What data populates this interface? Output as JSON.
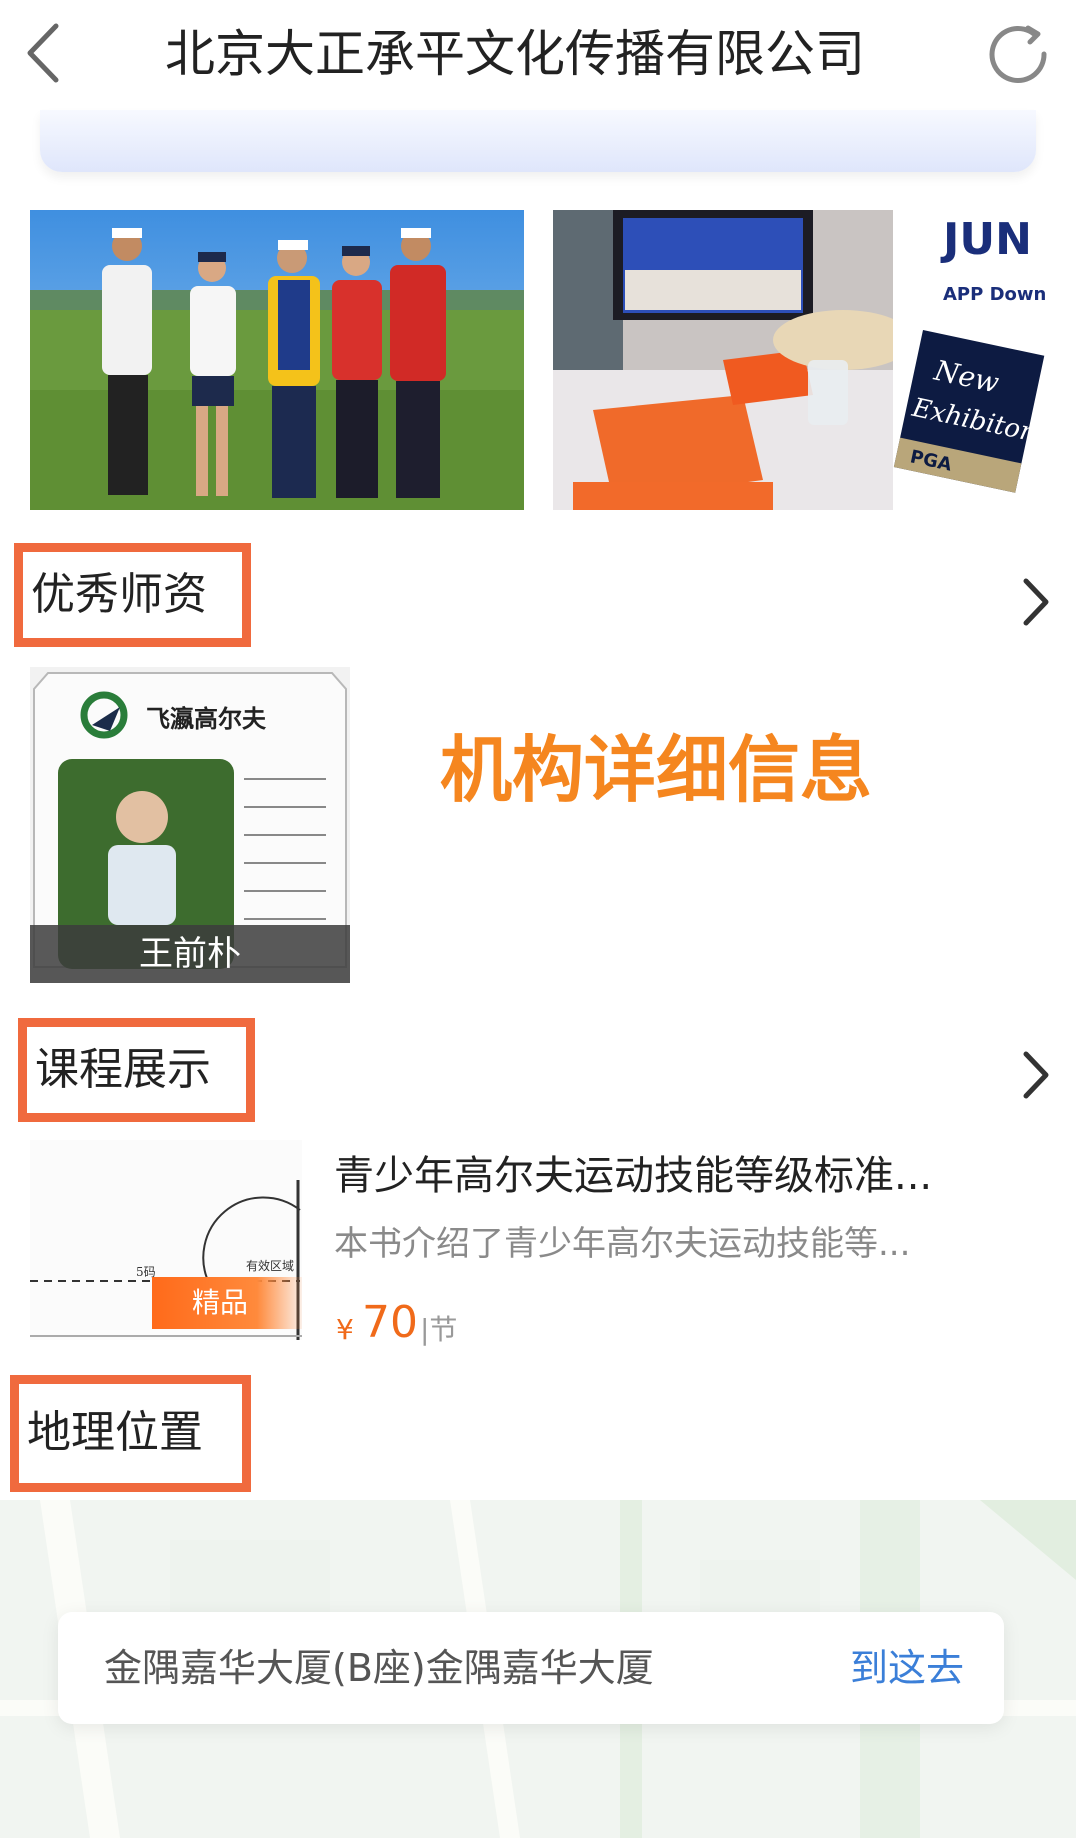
{
  "header": {
    "title": "北京大正承平文化传播有限公司",
    "back_icon": "chevron-left-icon",
    "refresh_icon": "refresh-icon"
  },
  "sections": {
    "teachers": {
      "label": "优秀师资"
    },
    "courses": {
      "label": "课程展示"
    },
    "location": {
      "label": "地理位置"
    }
  },
  "teacher_card": {
    "logo_text": "飞瀛高尔夫",
    "name": "王前朴"
  },
  "overlay_caption": "机构详细信息",
  "course": {
    "badge": "精品",
    "title": "青少年高尔夫运动技能等级标准...",
    "description": "本书介绍了青少年高尔夫运动技能等...",
    "price_currency": "¥",
    "price": "70",
    "price_unit": "|节",
    "diagram_labels": [
      "5码",
      "有效区域"
    ]
  },
  "photo2": {
    "banner_title": "JUN",
    "banner_sub": "APP Downlo",
    "badge_line1": "New",
    "badge_line2": "Exhibitor",
    "badge_footer": "PGA"
  },
  "location": {
    "address": "金隅嘉华大厦(B座)金隅嘉华大厦",
    "go_label": "到这去"
  },
  "colors": {
    "accent_orange": "#f06a3e",
    "price_orange": "#f06a1a",
    "link_blue": "#3b7fd8",
    "caption_orange": "#f5861f"
  }
}
